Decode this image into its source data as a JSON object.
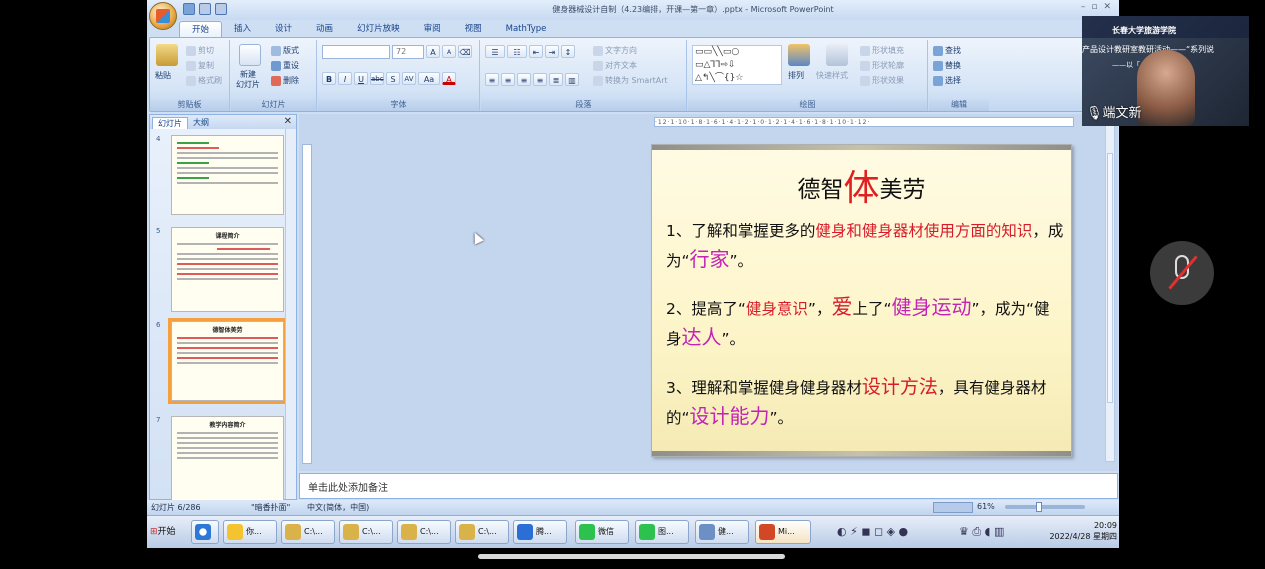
{
  "window": {
    "title": "健身器械设计自制（4.23编排，开课—第一章）.pptx - Microsoft PowerPoint",
    "minimize": "–",
    "restore": "▫",
    "close": "✕"
  },
  "tabs": [
    "开始",
    "插入",
    "设计",
    "动画",
    "幻灯片放映",
    "审阅",
    "视图",
    "MathType"
  ],
  "ribbon": {
    "clipboard": {
      "label": "剪贴板",
      "paste": "粘贴",
      "cut": "剪切",
      "copy": "复制",
      "format_painter": "格式刷"
    },
    "slides": {
      "label": "幻灯片",
      "new_slide": "新建\n幻灯片",
      "layout": "版式",
      "reset": "重设",
      "delete": "删除"
    },
    "font": {
      "label": "字体",
      "size": "72",
      "bold": "B",
      "italic": "I",
      "underline": "U",
      "strike": "abc",
      "shadow": "S",
      "spacing": "AV",
      "case": "Aa",
      "color": "A",
      "grow": "A",
      "shrink": "A"
    },
    "paragraph": {
      "label": "段落",
      "text_direction": "文字方向",
      "align_text": "对齐文本",
      "smartart": "转换为 SmartArt"
    },
    "drawing": {
      "label": "绘图",
      "arrange": "排列",
      "quick_styles": "快速样式",
      "shape_fill": "形状填充",
      "shape_outline": "形状轮廓",
      "shape_effects": "形状效果"
    },
    "editing": {
      "label": "编辑",
      "find": "查找",
      "replace": "替换",
      "select": "选择"
    }
  },
  "panel": {
    "tabs": [
      "幻灯片",
      "大纲"
    ],
    "close": "✕",
    "thumbnails": [
      {
        "num": "4",
        "title": ""
      },
      {
        "num": "5",
        "title": "课程简介"
      },
      {
        "num": "6",
        "title": "德智体美劳"
      },
      {
        "num": "7",
        "title": "教学内容简介"
      }
    ]
  },
  "ruler": "·12·1·10·1·8·1·6·1·4·1·2·1·0·1·2·1·4·1·6·1·8·1·10·1·12·",
  "slide": {
    "title_a": "德智",
    "title_b": "体",
    "title_c": "美劳",
    "p1_num": "1、了解和掌握更多的",
    "p1_red": "健身和健身器材使用方面的知识",
    "p1_mid": "，成为“",
    "p1_purple": "行家",
    "p1_end": "”。",
    "p2_num": "2、提高了“",
    "p2_red": "健身意识",
    "p2_mid": "”，",
    "p2_love": "爱",
    "p2_mid2": "上了“",
    "p2_purple": "健身运动",
    "p2_mid3": "”，成为“健身",
    "p2_purple2": "达人",
    "p2_end": "”。",
    "p3_num": "3、理解和掌握健身健身器材",
    "p3_red": "设计方法",
    "p3_mid": "，具有健身器材的“",
    "p3_purple": "设计能力",
    "p3_end": "”。"
  },
  "notes": {
    "placeholder": "单击此处添加备注"
  },
  "status": {
    "slide_count": "幻灯片 6/286",
    "theme": "\"暗香扑面\"",
    "language": "中文(简体，中国)",
    "zoom": "61%",
    "zoom_fraction": 0.61
  },
  "taskbar": {
    "start": "开始",
    "items": [
      "你...",
      "C:\\...",
      "C:\\...",
      "C:\\...",
      "C:\\...",
      "腾...",
      "微信",
      "图...",
      "健...",
      "Mi..."
    ],
    "time": "20:09",
    "date": "2022/4/28 星期四"
  },
  "video": {
    "school": "长春大学旅游学院",
    "sub": "产品设计教研室教研活动——“系列说",
    "sub2": "——以「          」课为例",
    "name": "端文新"
  },
  "colors": {
    "accent": "#d81b2a",
    "purple": "#c224b5",
    "ribbon": "#d5e4f6"
  }
}
